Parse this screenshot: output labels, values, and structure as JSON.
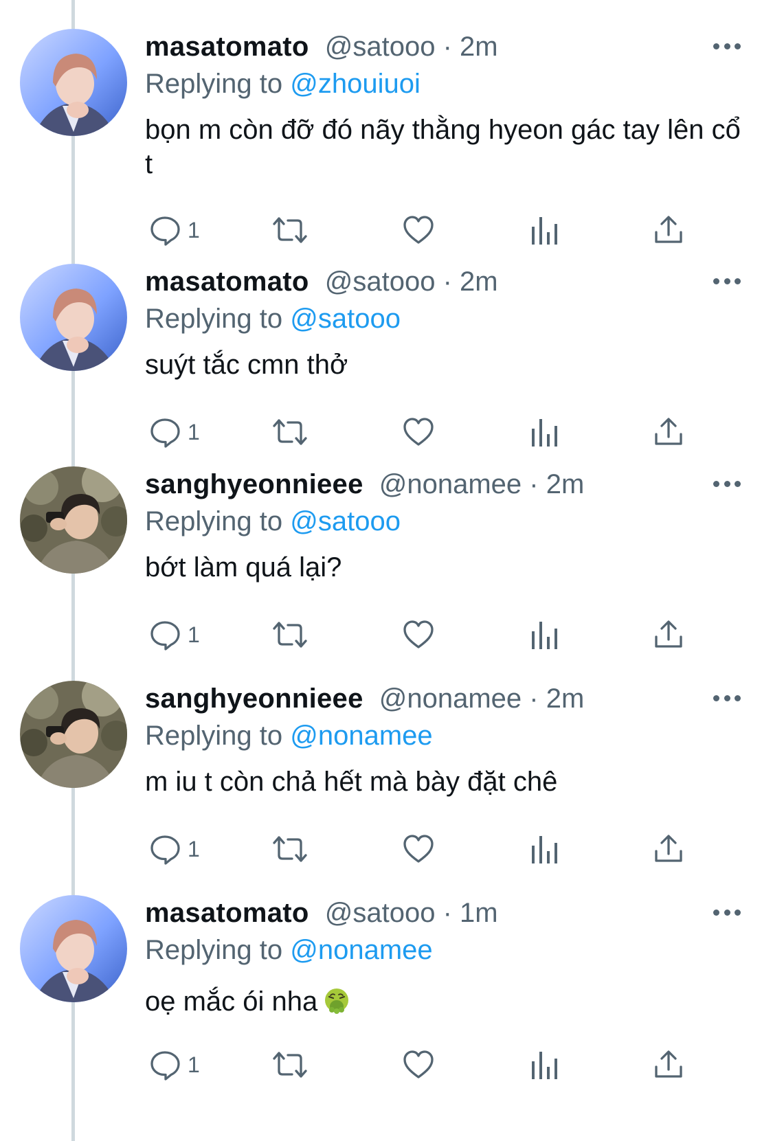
{
  "tweets": [
    {
      "display_name": "masatomato",
      "handle": "@satooo",
      "time": "2m",
      "replying_label": "Replying to",
      "reply_to": "@zhouiuoi",
      "text": "bọn m còn đỡ đó nãy thằng hyeon gác tay lên cổ t",
      "reply_count": "1",
      "avatar": "pink-hair-avatar"
    },
    {
      "display_name": "masatomato",
      "handle": "@satooo",
      "time": "2m",
      "replying_label": "Replying to",
      "reply_to": "@satooo",
      "text": "suýt tắc cmn thở",
      "reply_count": "1",
      "avatar": "pink-hair-avatar"
    },
    {
      "display_name": "sanghyeonnieee",
      "handle": "@nonamee",
      "time": "2m",
      "replying_label": "Replying to",
      "reply_to": "@satooo",
      "text": "bớt làm quá lại?",
      "reply_count": "1",
      "avatar": "outdoor-avatar"
    },
    {
      "display_name": "sanghyeonnieee",
      "handle": "@nonamee",
      "time": "2m",
      "replying_label": "Replying to",
      "reply_to": "@nonamee",
      "text": "m iu t còn chả hết mà bày đặt chê",
      "reply_count": "1",
      "avatar": "outdoor-avatar"
    },
    {
      "display_name": "masatomato",
      "handle": "@satooo",
      "time": "1m",
      "replying_label": "Replying to",
      "reply_to": "@nonamee",
      "text": "oẹ mắc ói nha",
      "emoji": "vomiting-face-emoji",
      "reply_count": "1",
      "avatar": "pink-hair-avatar"
    }
  ],
  "icons": [
    "reply-icon",
    "retweet-icon",
    "like-icon",
    "analytics-icon",
    "share-icon",
    "more-icon"
  ],
  "colors": {
    "text": "#0f1419",
    "secondary": "#536471",
    "link": "#1d9bf0",
    "thread_line": "#cfd9de"
  }
}
